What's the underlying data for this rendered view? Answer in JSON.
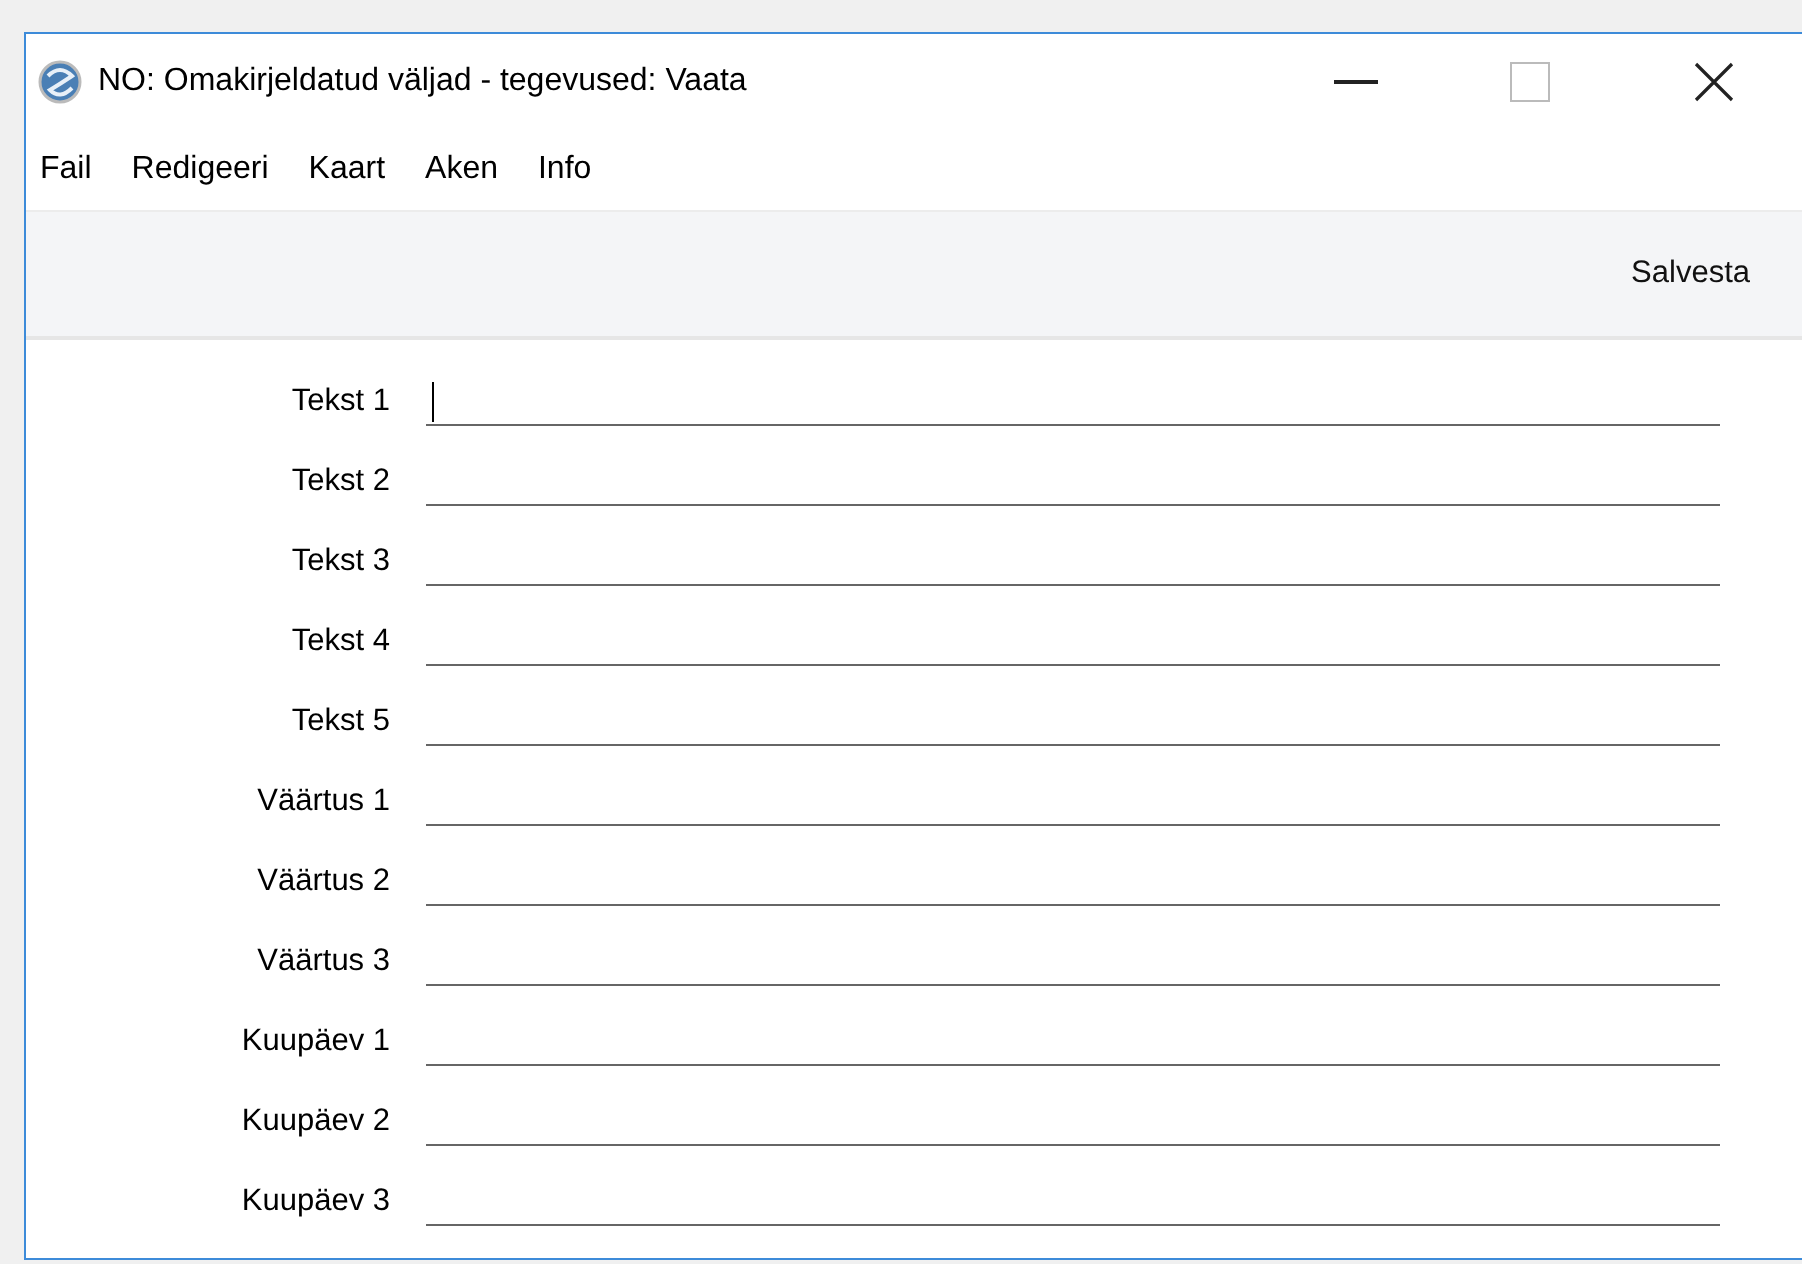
{
  "window": {
    "title": "NO: Omakirjeldatud väljad - tegevused: Vaata"
  },
  "menu": [
    "Fail",
    "Redigeeri",
    "Kaart",
    "Aken",
    "Info"
  ],
  "toolbar": {
    "buttons": [
      "Salvesta"
    ]
  },
  "fields": [
    {
      "label": "Tekst 1",
      "focused": true
    },
    {
      "label": "Tekst 2",
      "focused": false
    },
    {
      "label": "Tekst 3",
      "focused": false
    },
    {
      "label": "Tekst 4",
      "focused": false
    },
    {
      "label": "Tekst 5",
      "focused": false
    },
    {
      "label": "Väärtus 1",
      "focused": false
    },
    {
      "label": "Väärtus 2",
      "focused": false
    },
    {
      "label": "Väärtus 3",
      "focused": false
    },
    {
      "label": "Kuupäev 1",
      "focused": false
    },
    {
      "label": "Kuupäev 2",
      "focused": false
    },
    {
      "label": "Kuupäev 3",
      "focused": false
    }
  ]
}
